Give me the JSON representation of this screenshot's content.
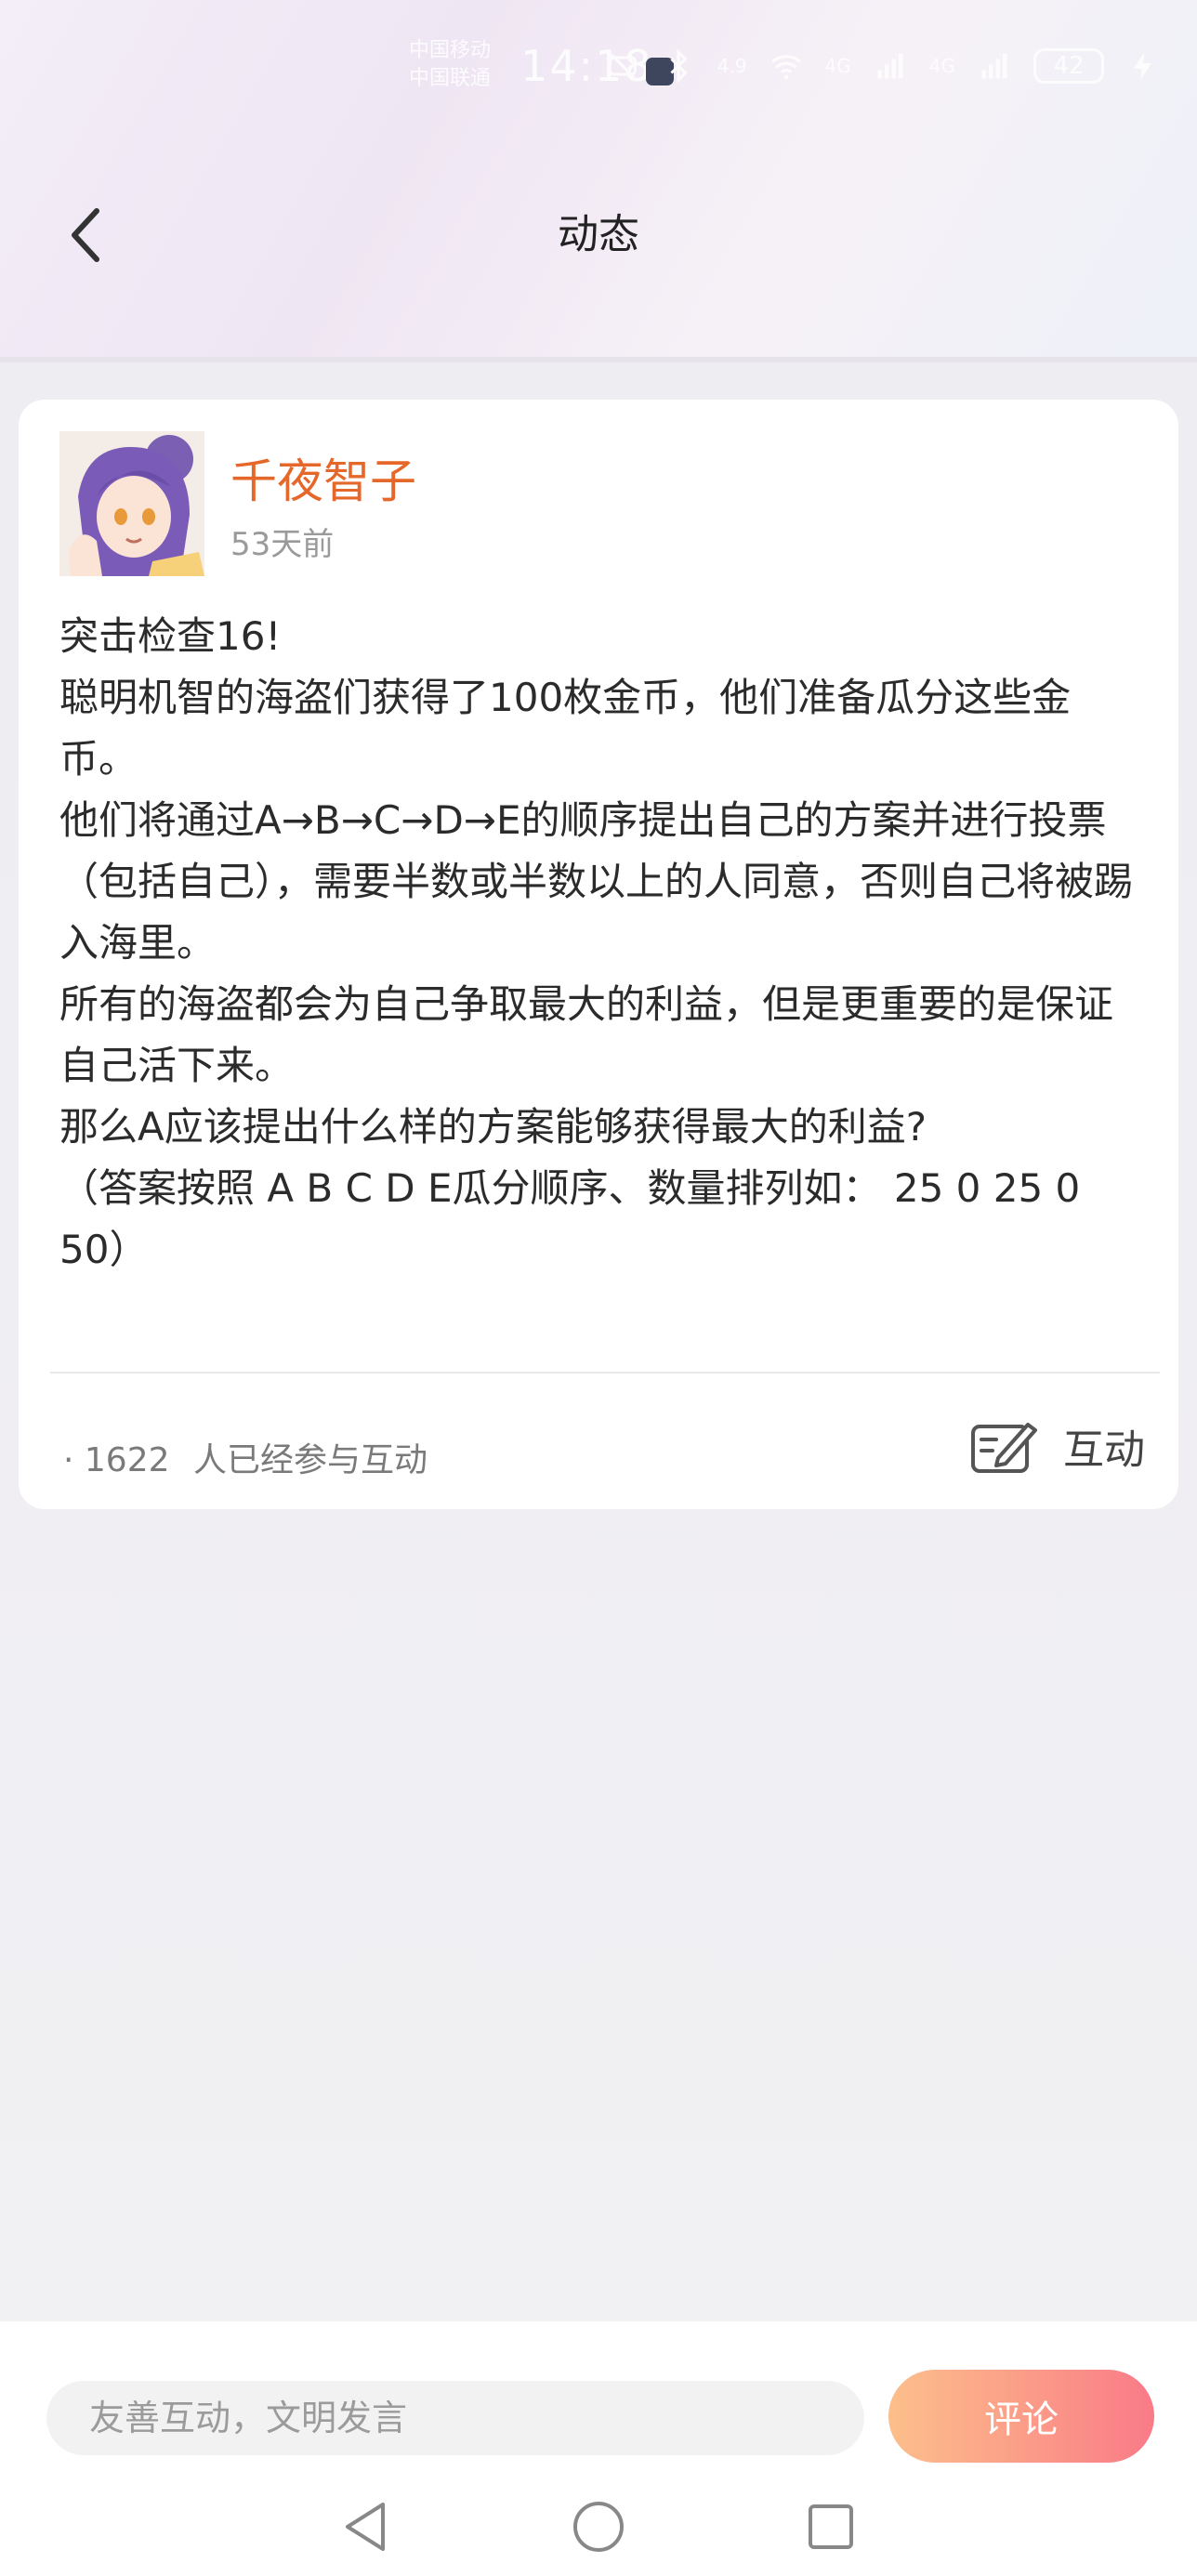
{
  "status_bar": {
    "carrier_line1": "中国移动",
    "carrier_line2": "中国联通",
    "time": "14:18",
    "battery_level": "42",
    "signal_label_1": "4G",
    "signal_label_2": "4G"
  },
  "header": {
    "title": "动态",
    "back_icon": "chevron-left-icon"
  },
  "post": {
    "author": "千夜智子",
    "time_ago": "53天前",
    "body": [
      "突击检查16!",
      "聪明机智的海盗们获得了100枚金币，他们准备瓜分这些金币。",
      "他们将通过A→B→C→D→E的顺序提出自己的方案并进行投票（包括自己），需要半数或半数以上的人同意，否则自己将被踢入海里。",
      "所有的海盗都会为自己争取最大的利益，但是更重要的是保证自己活下来。",
      "那么A应该提出什么样的方案能够获得最大的利益?",
      "（答案按照 A B C D E瓜分顺序、数量排列如： 25 0 25 0 50）"
    ],
    "participation_prefix": "· 1622",
    "participation_suffix": "人已经参与互动",
    "interact_label": "互动",
    "interact_icon": "edit-note-icon"
  },
  "comment_bar": {
    "placeholder": "友善互动，文明发言",
    "button_label": "评论"
  },
  "colors": {
    "author": "#e6672a",
    "button_gradient_start": "#fcbf8a",
    "button_gradient_end": "#f97a88"
  }
}
